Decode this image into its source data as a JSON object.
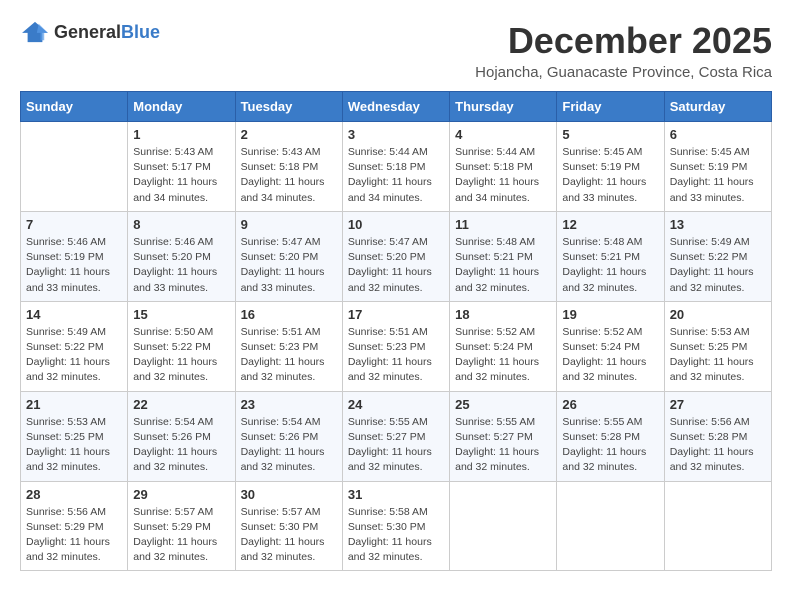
{
  "logo": {
    "general": "General",
    "blue": "Blue"
  },
  "title": "December 2025",
  "subtitle": "Hojancha, Guanacaste Province, Costa Rica",
  "days": [
    "Sunday",
    "Monday",
    "Tuesday",
    "Wednesday",
    "Thursday",
    "Friday",
    "Saturday"
  ],
  "weeks": [
    [
      {
        "date": "",
        "info": ""
      },
      {
        "date": "1",
        "info": "Sunrise: 5:43 AM\nSunset: 5:17 PM\nDaylight: 11 hours\nand 34 minutes."
      },
      {
        "date": "2",
        "info": "Sunrise: 5:43 AM\nSunset: 5:18 PM\nDaylight: 11 hours\nand 34 minutes."
      },
      {
        "date": "3",
        "info": "Sunrise: 5:44 AM\nSunset: 5:18 PM\nDaylight: 11 hours\nand 34 minutes."
      },
      {
        "date": "4",
        "info": "Sunrise: 5:44 AM\nSunset: 5:18 PM\nDaylight: 11 hours\nand 34 minutes."
      },
      {
        "date": "5",
        "info": "Sunrise: 5:45 AM\nSunset: 5:19 PM\nDaylight: 11 hours\nand 33 minutes."
      },
      {
        "date": "6",
        "info": "Sunrise: 5:45 AM\nSunset: 5:19 PM\nDaylight: 11 hours\nand 33 minutes."
      }
    ],
    [
      {
        "date": "7",
        "info": "Sunrise: 5:46 AM\nSunset: 5:19 PM\nDaylight: 11 hours\nand 33 minutes."
      },
      {
        "date": "8",
        "info": "Sunrise: 5:46 AM\nSunset: 5:20 PM\nDaylight: 11 hours\nand 33 minutes."
      },
      {
        "date": "9",
        "info": "Sunrise: 5:47 AM\nSunset: 5:20 PM\nDaylight: 11 hours\nand 33 minutes."
      },
      {
        "date": "10",
        "info": "Sunrise: 5:47 AM\nSunset: 5:20 PM\nDaylight: 11 hours\nand 32 minutes."
      },
      {
        "date": "11",
        "info": "Sunrise: 5:48 AM\nSunset: 5:21 PM\nDaylight: 11 hours\nand 32 minutes."
      },
      {
        "date": "12",
        "info": "Sunrise: 5:48 AM\nSunset: 5:21 PM\nDaylight: 11 hours\nand 32 minutes."
      },
      {
        "date": "13",
        "info": "Sunrise: 5:49 AM\nSunset: 5:22 PM\nDaylight: 11 hours\nand 32 minutes."
      }
    ],
    [
      {
        "date": "14",
        "info": "Sunrise: 5:49 AM\nSunset: 5:22 PM\nDaylight: 11 hours\nand 32 minutes."
      },
      {
        "date": "15",
        "info": "Sunrise: 5:50 AM\nSunset: 5:22 PM\nDaylight: 11 hours\nand 32 minutes."
      },
      {
        "date": "16",
        "info": "Sunrise: 5:51 AM\nSunset: 5:23 PM\nDaylight: 11 hours\nand 32 minutes."
      },
      {
        "date": "17",
        "info": "Sunrise: 5:51 AM\nSunset: 5:23 PM\nDaylight: 11 hours\nand 32 minutes."
      },
      {
        "date": "18",
        "info": "Sunrise: 5:52 AM\nSunset: 5:24 PM\nDaylight: 11 hours\nand 32 minutes."
      },
      {
        "date": "19",
        "info": "Sunrise: 5:52 AM\nSunset: 5:24 PM\nDaylight: 11 hours\nand 32 minutes."
      },
      {
        "date": "20",
        "info": "Sunrise: 5:53 AM\nSunset: 5:25 PM\nDaylight: 11 hours\nand 32 minutes."
      }
    ],
    [
      {
        "date": "21",
        "info": "Sunrise: 5:53 AM\nSunset: 5:25 PM\nDaylight: 11 hours\nand 32 minutes."
      },
      {
        "date": "22",
        "info": "Sunrise: 5:54 AM\nSunset: 5:26 PM\nDaylight: 11 hours\nand 32 minutes."
      },
      {
        "date": "23",
        "info": "Sunrise: 5:54 AM\nSunset: 5:26 PM\nDaylight: 11 hours\nand 32 minutes."
      },
      {
        "date": "24",
        "info": "Sunrise: 5:55 AM\nSunset: 5:27 PM\nDaylight: 11 hours\nand 32 minutes."
      },
      {
        "date": "25",
        "info": "Sunrise: 5:55 AM\nSunset: 5:27 PM\nDaylight: 11 hours\nand 32 minutes."
      },
      {
        "date": "26",
        "info": "Sunrise: 5:55 AM\nSunset: 5:28 PM\nDaylight: 11 hours\nand 32 minutes."
      },
      {
        "date": "27",
        "info": "Sunrise: 5:56 AM\nSunset: 5:28 PM\nDaylight: 11 hours\nand 32 minutes."
      }
    ],
    [
      {
        "date": "28",
        "info": "Sunrise: 5:56 AM\nSunset: 5:29 PM\nDaylight: 11 hours\nand 32 minutes."
      },
      {
        "date": "29",
        "info": "Sunrise: 5:57 AM\nSunset: 5:29 PM\nDaylight: 11 hours\nand 32 minutes."
      },
      {
        "date": "30",
        "info": "Sunrise: 5:57 AM\nSunset: 5:30 PM\nDaylight: 11 hours\nand 32 minutes."
      },
      {
        "date": "31",
        "info": "Sunrise: 5:58 AM\nSunset: 5:30 PM\nDaylight: 11 hours\nand 32 minutes."
      },
      {
        "date": "",
        "info": ""
      },
      {
        "date": "",
        "info": ""
      },
      {
        "date": "",
        "info": ""
      }
    ]
  ]
}
